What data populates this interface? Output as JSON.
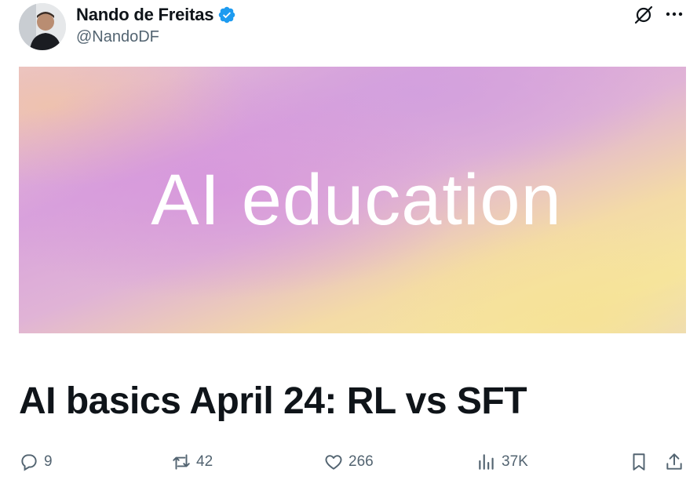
{
  "post": {
    "author": {
      "display_name": "Nando de Freitas",
      "handle": "@NandoDF",
      "verified": true,
      "verified_color": "#1d9bf0"
    },
    "media": {
      "banner_text": "AI education"
    },
    "headline": "AI basics April 24: RL vs SFT",
    "actions": {
      "replies": "9",
      "reposts": "42",
      "likes": "266",
      "views": "37K"
    }
  },
  "icons": {
    "top_right": [
      "grok-icon",
      "more-icon"
    ],
    "actions": [
      "reply-icon",
      "repost-icon",
      "like-icon",
      "views-icon",
      "bookmark-icon",
      "share-icon"
    ]
  },
  "colors": {
    "text_primary": "#0f1419",
    "text_secondary": "#536471",
    "accent": "#1d9bf0"
  }
}
